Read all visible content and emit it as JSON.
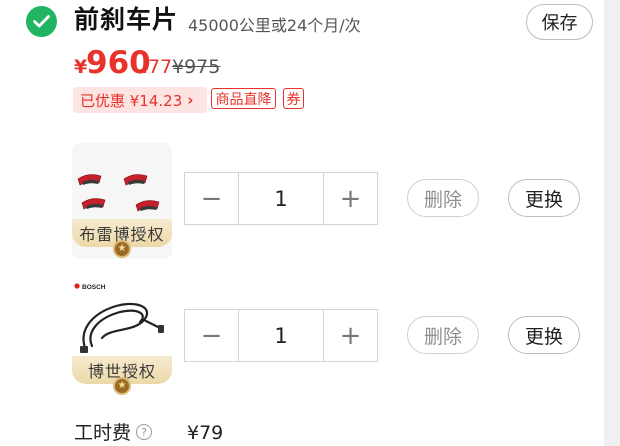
{
  "item": {
    "title": "前刹车片",
    "subtitle": "45000公里或24个月/次",
    "save_label": "保存",
    "price": {
      "currency": "¥",
      "integer": "960",
      "decimal": ".77",
      "original": "¥975"
    },
    "discount": {
      "label": "已优惠 ¥14.23",
      "arrow": "›"
    },
    "tags": [
      "商品直降",
      "券"
    ],
    "colors": {
      "accent_red": "#e8322a",
      "check_green": "#21b463",
      "badge_gold": "#ecd8a8"
    }
  },
  "products": [
    {
      "image": "brake-pads-image",
      "badge": "布雷博授权",
      "quantity": "1",
      "minus_label": "−",
      "plus_label": "+",
      "delete_label": "删除",
      "replace_label": "更换"
    },
    {
      "image": "wear-sensor-image",
      "brand_logo": "BOSCH",
      "badge": "博世授权",
      "quantity": "1",
      "minus_label": "−",
      "plus_label": "+",
      "delete_label": "删除",
      "replace_label": "更换"
    }
  ],
  "labor": {
    "label": "工时费",
    "help_icon": "?",
    "price": "¥79"
  }
}
